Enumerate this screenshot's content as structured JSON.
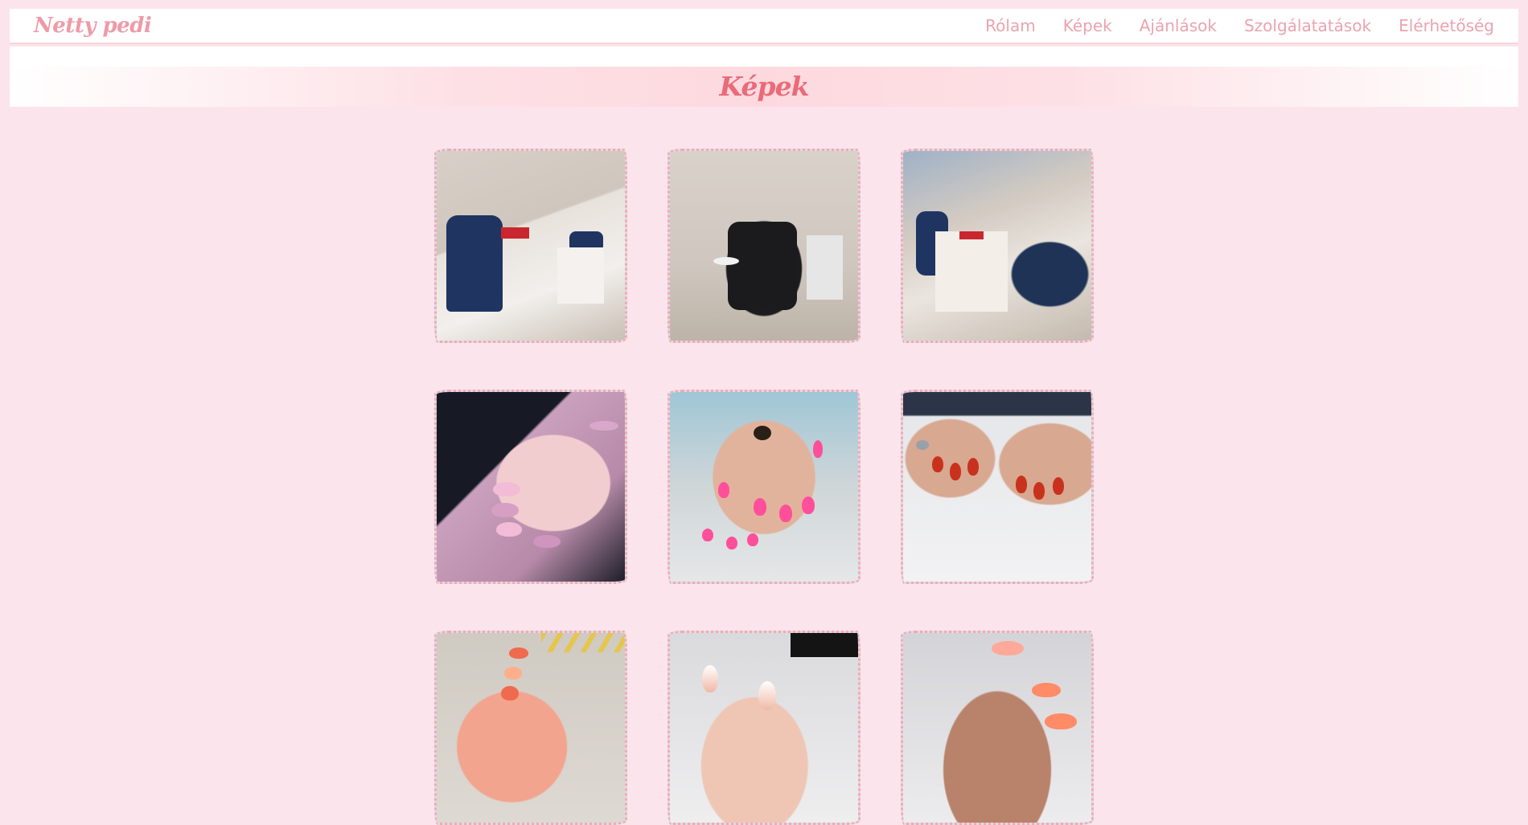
{
  "header": {
    "brand": "Netty pedi",
    "nav": [
      "Rólam",
      "Képek",
      "Ajánlások",
      "Szolgálatatások",
      "Elérhetőség"
    ]
  },
  "main": {
    "title": "Képek"
  },
  "gallery": {
    "photos": [
      {
        "name": "photo-salon-desk"
      },
      {
        "name": "photo-pedicure-chair"
      },
      {
        "name": "photo-salon-desk-window"
      },
      {
        "name": "photo-pink-almond-nails"
      },
      {
        "name": "photo-hot-pink-nails"
      },
      {
        "name": "photo-red-nails"
      },
      {
        "name": "photo-orange-nails"
      },
      {
        "name": "photo-ombre-nails"
      },
      {
        "name": "photo-coral-nails"
      }
    ]
  },
  "colors": {
    "page_bg": "#fce4ec",
    "brand": "#ee9aa8",
    "title": "#ea6b78",
    "nav_text": "#eba3ae",
    "photo_border": "#f4a7b9"
  }
}
